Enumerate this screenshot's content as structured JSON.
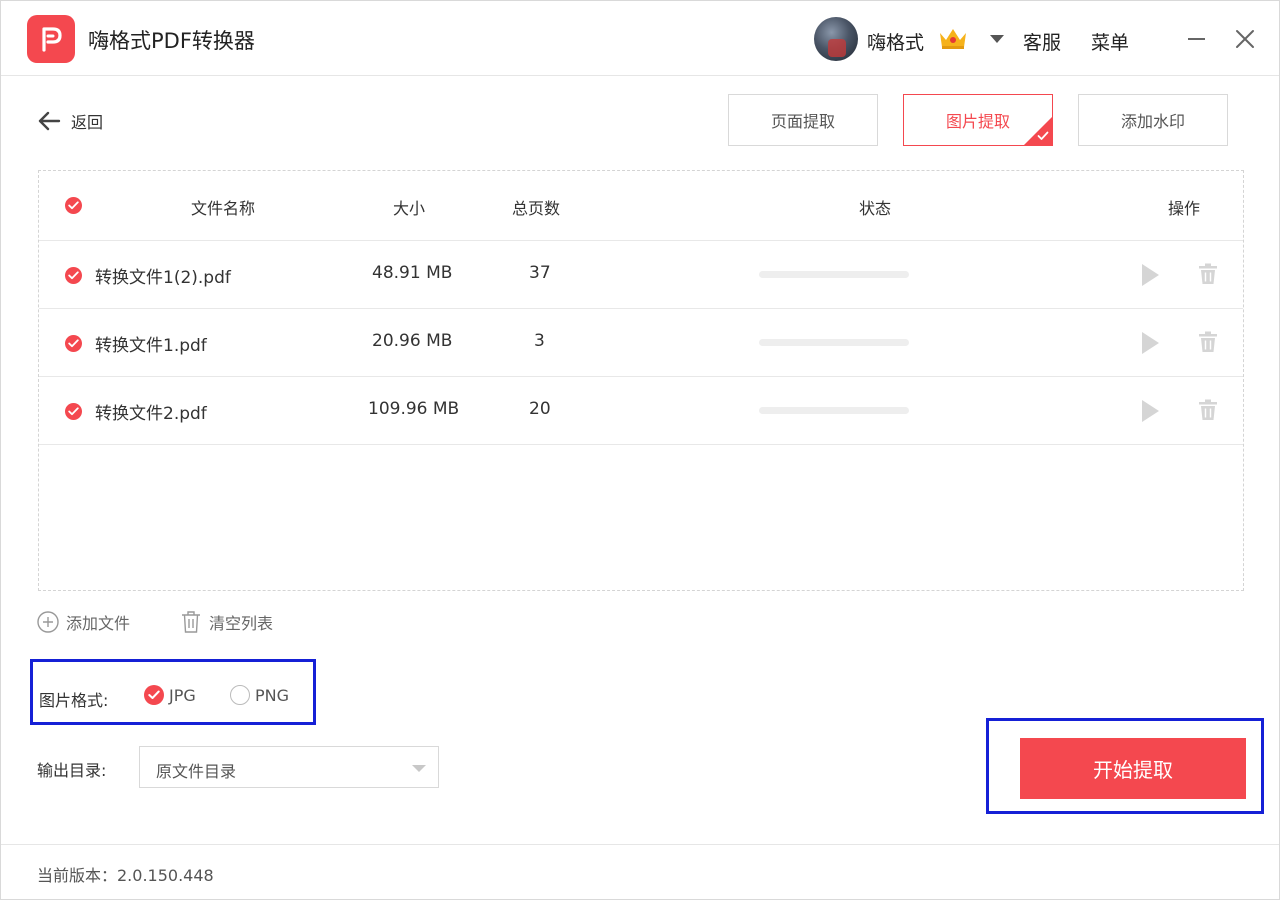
{
  "app": {
    "title": "嗨格式PDF转换器",
    "username": "嗨格式",
    "service_label": "客服",
    "menu_label": "菜单"
  },
  "nav": {
    "back_label": "返回"
  },
  "modes": [
    {
      "label": "页面提取",
      "active": false
    },
    {
      "label": "图片提取",
      "active": true
    },
    {
      "label": "添加水印",
      "active": false
    }
  ],
  "table": {
    "headers": {
      "name": "文件名称",
      "size": "大小",
      "pages": "总页数",
      "status": "状态",
      "actions": "操作"
    },
    "rows": [
      {
        "name": "转换文件1(2).pdf",
        "size": "48.91 MB",
        "pages": "37",
        "progress": 0
      },
      {
        "name": "转换文件1.pdf",
        "size": "20.96 MB",
        "pages": "3",
        "progress": 0
      },
      {
        "name": "转换文件2.pdf",
        "size": "109.96 MB",
        "pages": "20",
        "progress": 0
      }
    ]
  },
  "file_actions": {
    "add_label": "添加文件",
    "clear_label": "清空列表"
  },
  "format": {
    "label": "图片格式:",
    "options": [
      {
        "label": "JPG",
        "checked": true
      },
      {
        "label": "PNG",
        "checked": false
      }
    ]
  },
  "output": {
    "label": "输出目录:",
    "value": "原文件目录"
  },
  "start_label": "开始提取",
  "footer": {
    "version_text": "当前版本：2.0.150.448"
  },
  "colors": {
    "accent": "#f4484f",
    "highlight_border": "#1520d6"
  }
}
